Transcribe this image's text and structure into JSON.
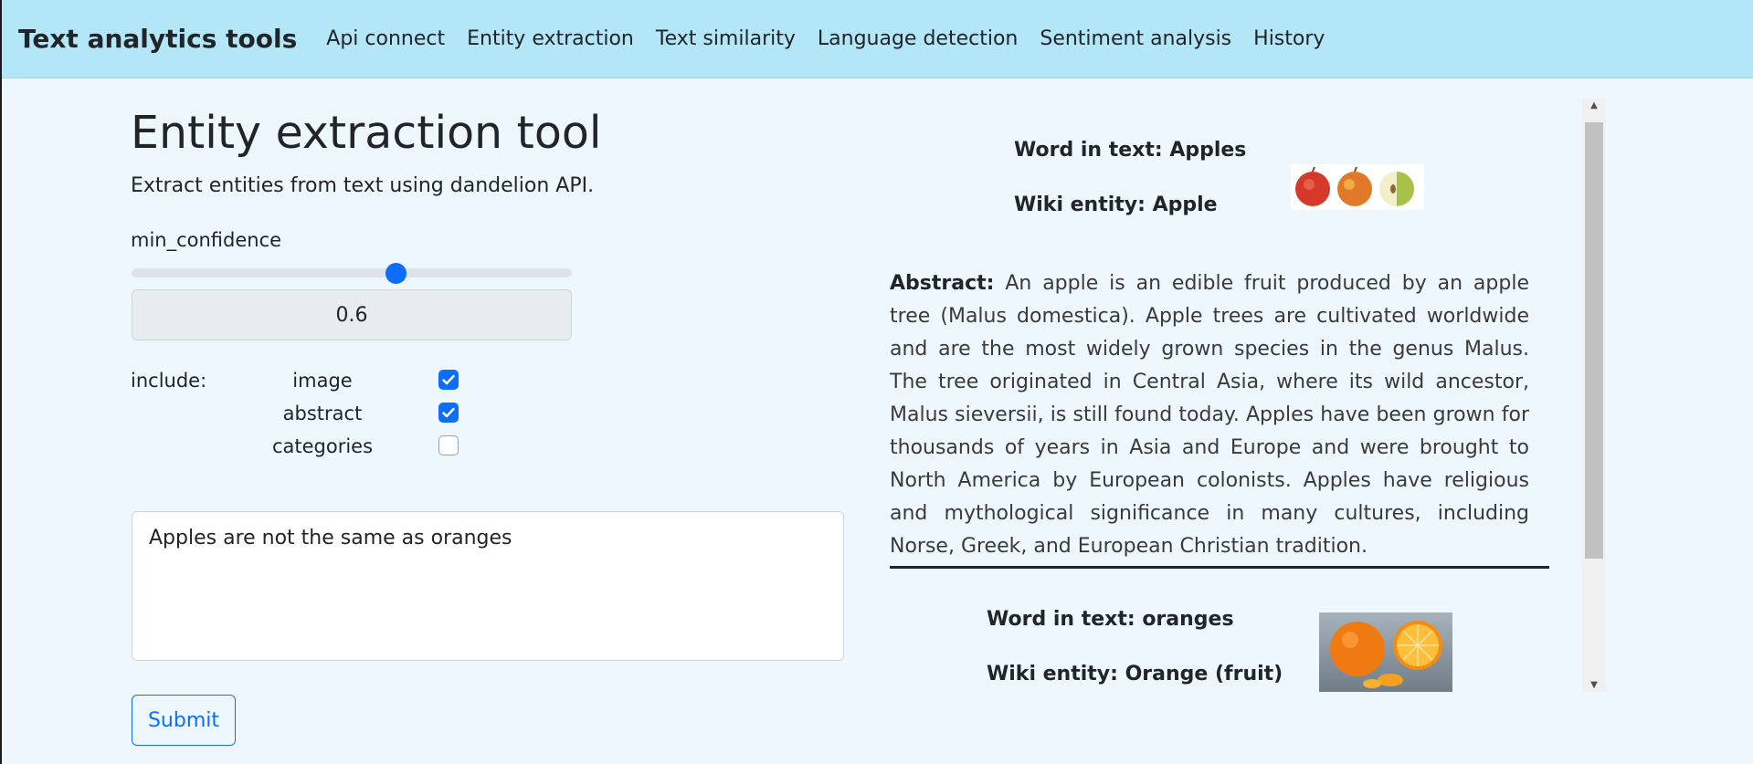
{
  "navbar": {
    "brand": "Text analytics tools",
    "links": [
      "Api connect",
      "Entity extraction",
      "Text similarity",
      "Language detection",
      "Sentiment analysis",
      "History"
    ]
  },
  "form": {
    "title": "Entity extraction tool",
    "subtitle": "Extract entities from text using dandelion API.",
    "min_confidence_label": "min_confidence",
    "min_confidence_value": "0.6",
    "slider_fraction": 0.6,
    "include_label": "include:",
    "options": [
      {
        "label": "image",
        "checked": true
      },
      {
        "label": "abstract",
        "checked": true
      },
      {
        "label": "categories",
        "checked": false
      }
    ],
    "input_text": "Apples are not the same as oranges",
    "submit_label": "Submit"
  },
  "results": [
    {
      "word": "Word in text: Apples",
      "wiki": "Wiki entity: Apple",
      "image_icon": "apple-image",
      "abstract_label": "Abstract:",
      "abstract": "An apple is an edible fruit produced by an apple tree (Malus domestica). Apple trees are cultivated worldwide and are the most widely grown species in the genus Malus. The tree originated in Central Asia, where its wild ancestor, Malus sieversii, is still found today. Apples have been grown for thousands of years in Asia and Europe and were brought to North America by European colonists. Apples have religious and mythological significance in many cultures, including Norse, Greek, and European Christian tradition."
    },
    {
      "word": "Word in text: oranges",
      "wiki": "Wiki entity: Orange (fruit)",
      "image_icon": "orange-image"
    }
  ],
  "colors": {
    "navbar": "#b3e6f7",
    "background": "#eef7fd",
    "accent": "#0d6efd"
  }
}
